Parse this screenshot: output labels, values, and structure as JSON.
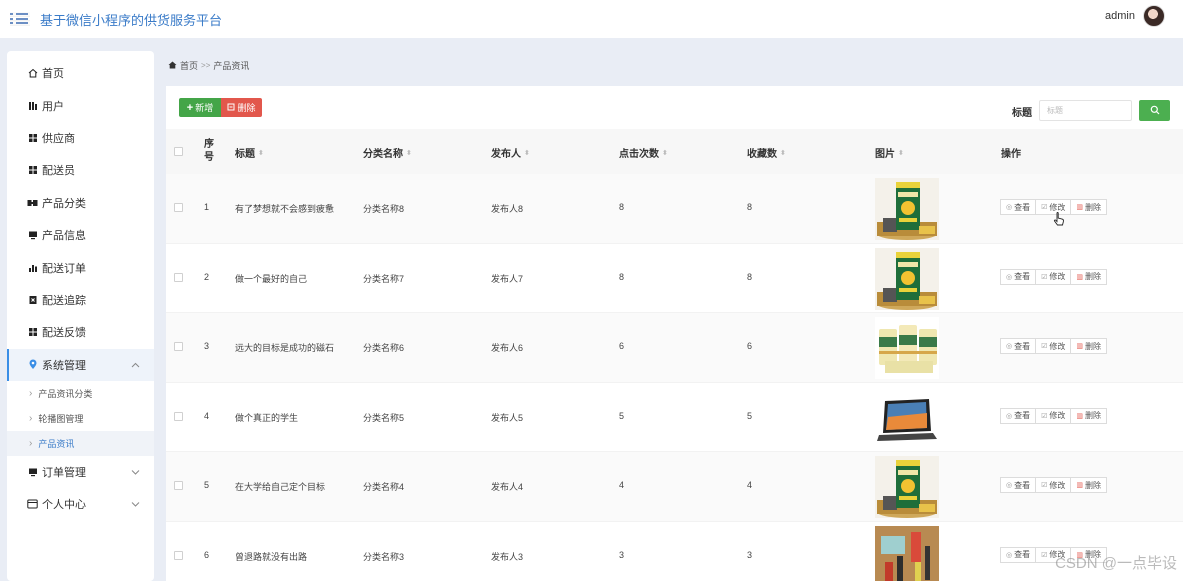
{
  "header": {
    "title": "基于微信小程序的供货服务平台",
    "username": "admin"
  },
  "sidebar": {
    "items": [
      {
        "label": "首页",
        "icon": "home-icon"
      },
      {
        "label": "用户",
        "icon": "users-icon"
      },
      {
        "label": "供应商",
        "icon": "grid-icon"
      },
      {
        "label": "配送员",
        "icon": "grid-icon"
      },
      {
        "label": "产品分类",
        "icon": "category-icon"
      },
      {
        "label": "产品信息",
        "icon": "monitor-icon"
      },
      {
        "label": "配送订单",
        "icon": "bar-chart-icon"
      },
      {
        "label": "配送追踪",
        "icon": "tracking-icon"
      },
      {
        "label": "配送反馈",
        "icon": "grid-icon"
      },
      {
        "label": "系统管理",
        "icon": "pin-icon"
      },
      {
        "label": "订单管理",
        "icon": "monitor-icon"
      },
      {
        "label": "个人中心",
        "icon": "window-icon"
      }
    ],
    "system_sub": [
      "产品资讯分类",
      "轮播图管理",
      "产品资讯"
    ]
  },
  "breadcrumb": {
    "home": "首页",
    "sep": ">>",
    "current": "产品资讯"
  },
  "toolbar": {
    "add_label": "新增",
    "delete_label": "删除",
    "search_label": "标题",
    "search_placeholder": "标题"
  },
  "table": {
    "headers": {
      "index": "序号",
      "title": "标题",
      "category": "分类名称",
      "publisher": "发布人",
      "clicks": "点击次数",
      "favorites": "收藏数",
      "image": "图片",
      "actions": "操作"
    },
    "actions": {
      "view": "查看",
      "edit": "修改",
      "delete": "删除"
    },
    "rows": [
      {
        "index": "1",
        "title": "有了梦想就不会感到疲惫",
        "category": "分类名称8",
        "publisher": "发布人8",
        "clicks": "8",
        "favorites": "8",
        "image": "oil-tin"
      },
      {
        "index": "2",
        "title": "做一个最好的自己",
        "category": "分类名称7",
        "publisher": "发布人7",
        "clicks": "8",
        "favorites": "8",
        "image": "oil-tin"
      },
      {
        "index": "3",
        "title": "远大的目标是成功的磁石",
        "category": "分类名称6",
        "publisher": "发布人6",
        "clicks": "6",
        "favorites": "6",
        "image": "milk-cans"
      },
      {
        "index": "4",
        "title": "做个真正的学生",
        "category": "分类名称5",
        "publisher": "发布人5",
        "clicks": "5",
        "favorites": "5",
        "image": "laptop"
      },
      {
        "index": "5",
        "title": "在大学给自己定个目标",
        "category": "分类名称4",
        "publisher": "发布人4",
        "clicks": "4",
        "favorites": "4",
        "image": "oil-tin"
      },
      {
        "index": "6",
        "title": "曾退路就没有出路",
        "category": "分类名称3",
        "publisher": "发布人3",
        "clicks": "3",
        "favorites": "3",
        "image": "tools"
      }
    ]
  },
  "watermark": "CSDN @一点毕设",
  "colors": {
    "accent": "#3a7bc8",
    "add": "#44a548",
    "delete": "#e2574c",
    "search": "#4caf50"
  }
}
